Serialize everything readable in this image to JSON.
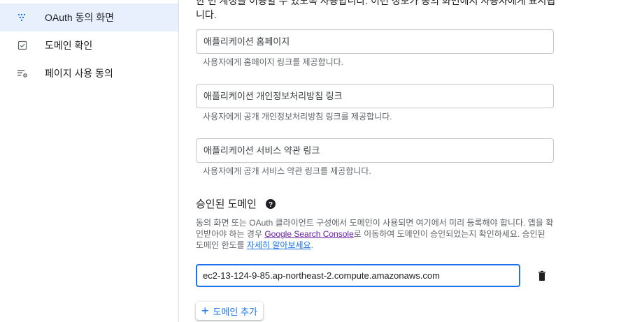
{
  "sidebar": {
    "items": [
      {
        "label": "OAuth 동의 화면",
        "icon": "oauth-consent-icon",
        "active": true
      },
      {
        "label": "도메인 확인",
        "icon": "checkbox-icon",
        "active": false
      },
      {
        "label": "페이지 사용 동의",
        "icon": "settings-list-icon",
        "active": false
      }
    ]
  },
  "main": {
    "clipped_description": "한 번 계정을 이용할 수 있도록 사용합니다. 이런 정보가 동의 화면에서 사용자에게 표시됩니다.",
    "fields": [
      {
        "placeholder": "애플리케이션 홈페이지",
        "helper": "사용자에게 홈페이지 링크를 제공합니다."
      },
      {
        "placeholder": "애플리케이션 개인정보처리방침 링크",
        "helper": "사용자에게 공개 개인정보처리방침 링크를 제공합니다."
      },
      {
        "placeholder": "애플리케이션 서비스 약관 링크",
        "helper": "사용자에게 공개 서비스 약관 링크를 제공합니다."
      }
    ],
    "authorized_domains": {
      "title": "승인된 도메인",
      "help_icon": "help-circle-icon",
      "paragraph_1": "동의 화면 또는 OAuth 클라이언트 구성에서 도메인이 사용되면 여기에서 미리 등록해야 합니다. 앱을 확인받아야 하는 경우 ",
      "link_console": "Google Search Console",
      "paragraph_2": "로 이동하여 도메인이 승인되었는지 확인하세요. 승인된 도메인 한도를 ",
      "link_learn_more": "자세히 알아보세요",
      "paragraph_3": ".",
      "domain_value": "ec2-13-124-9-85.ap-northeast-2.compute.amazonaws.com",
      "delete_icon": "trash-icon",
      "add_button_label": "도메인 추가"
    }
  },
  "colors": {
    "accent": "#1a73e8",
    "active_nav_bg": "#e8f0fe",
    "visited_link": "#681da8"
  }
}
